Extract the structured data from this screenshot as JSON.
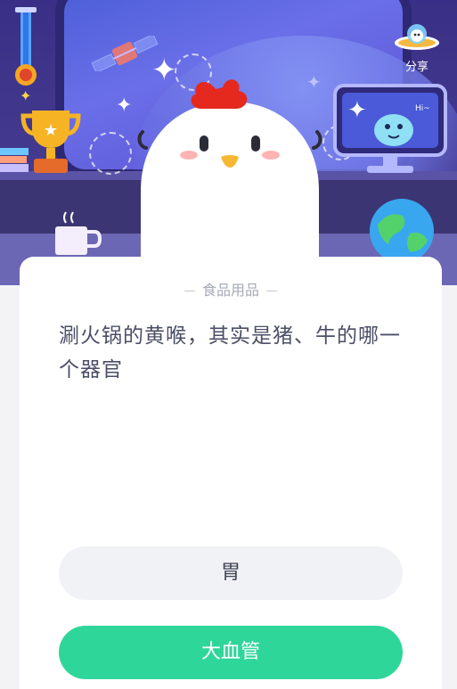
{
  "header": {
    "share_label": "分享",
    "monitor_text": "Hi~"
  },
  "card": {
    "category": "食品用品",
    "question": "涮火锅的黄喉，其实是猪、牛的哪一个器官"
  },
  "options": [
    {
      "label": "胃"
    },
    {
      "label": "大血管"
    }
  ],
  "colors": {
    "scene_bg": "#3a2f86",
    "option_default": "#f1f2f5",
    "option_accent": "#2fd69a",
    "question_text": "#4a4f66",
    "category_text": "#a6a9b6"
  }
}
